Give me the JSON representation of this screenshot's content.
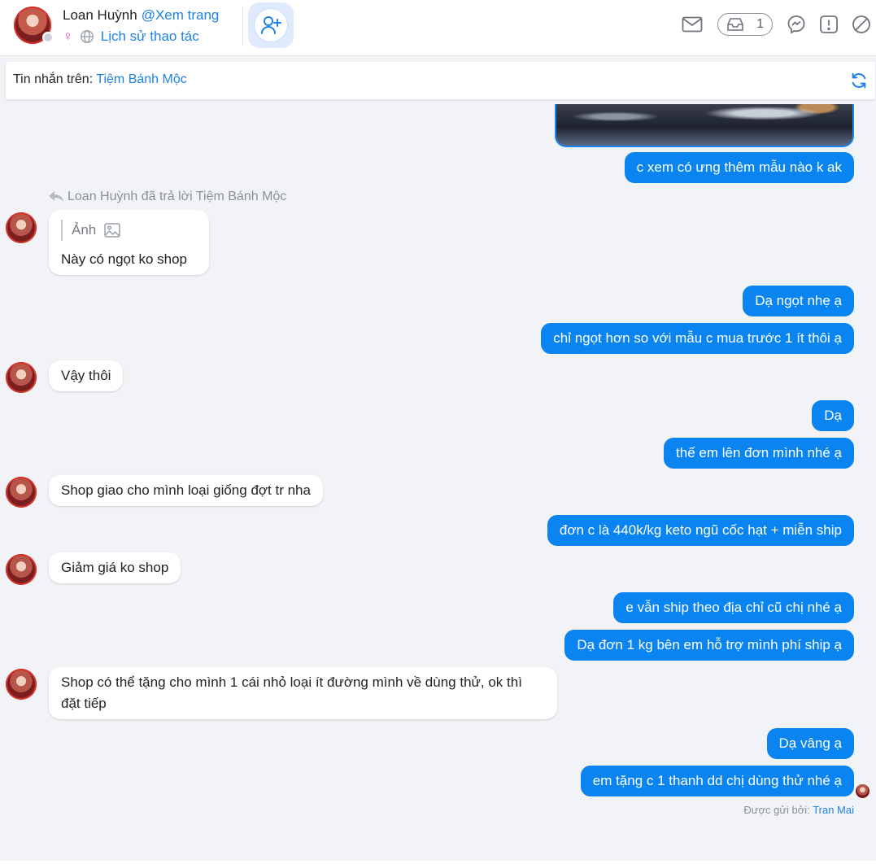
{
  "header": {
    "contact_name": "Loan Huỳnh",
    "view_page_link": "@Xem trang",
    "gender_symbol": "♀",
    "history_link": "Lịch sử thao tác",
    "inbox_count": "1"
  },
  "source_bar": {
    "label": "Tin nhắn trên: ",
    "page_name": "Tiệm Bánh Mộc"
  },
  "reply_note": "Loan Huỳnh đã trả lời Tiệm Bánh Mộc",
  "quoted": {
    "label": "Ảnh",
    "message": "Này có ngọt ko shop"
  },
  "messages": [
    {
      "dir": "out",
      "text": "c xem có ưng thêm mẫu nào k ak"
    },
    {
      "dir": "out",
      "text": "Dạ ngọt nhẹ ạ"
    },
    {
      "dir": "out",
      "text": "chỉ ngọt hơn so với mẫu c mua trước 1 ít thôi ạ"
    },
    {
      "dir": "in",
      "text": "Vậy thôi"
    },
    {
      "dir": "out",
      "text": "Dạ"
    },
    {
      "dir": "out",
      "text": "thế em lên đơn mình nhé ạ"
    },
    {
      "dir": "in",
      "text": "Shop giao cho mình loại giống đợt tr nha"
    },
    {
      "dir": "out",
      "text": "đơn c là 440k/kg keto ngũ cốc hạt + miễn ship"
    },
    {
      "dir": "in",
      "text": "Giảm giá ko shop"
    },
    {
      "dir": "out",
      "text": "e vẫn ship theo địa chỉ cũ chị nhé ạ"
    },
    {
      "dir": "out",
      "text": "Dạ đơn 1 kg bên em hỗ trợ mình phí ship ạ"
    },
    {
      "dir": "in",
      "text": "Shop có thể tặng cho mình 1 cái nhỏ loại ít đường mình về dùng thử, ok thì đặt tiếp"
    },
    {
      "dir": "out",
      "text": "Dạ vâng ạ"
    },
    {
      "dir": "out",
      "text": "em tặng c 1 thanh dd chị dùng thử nhé ạ"
    }
  ],
  "sent_by": {
    "label": "Được gửi bởi: ",
    "name": "Tran Mai"
  },
  "colors": {
    "accent": "#1e82e6",
    "outgoing_bubble": "#0a84f0",
    "background": "#f2f3f7"
  }
}
